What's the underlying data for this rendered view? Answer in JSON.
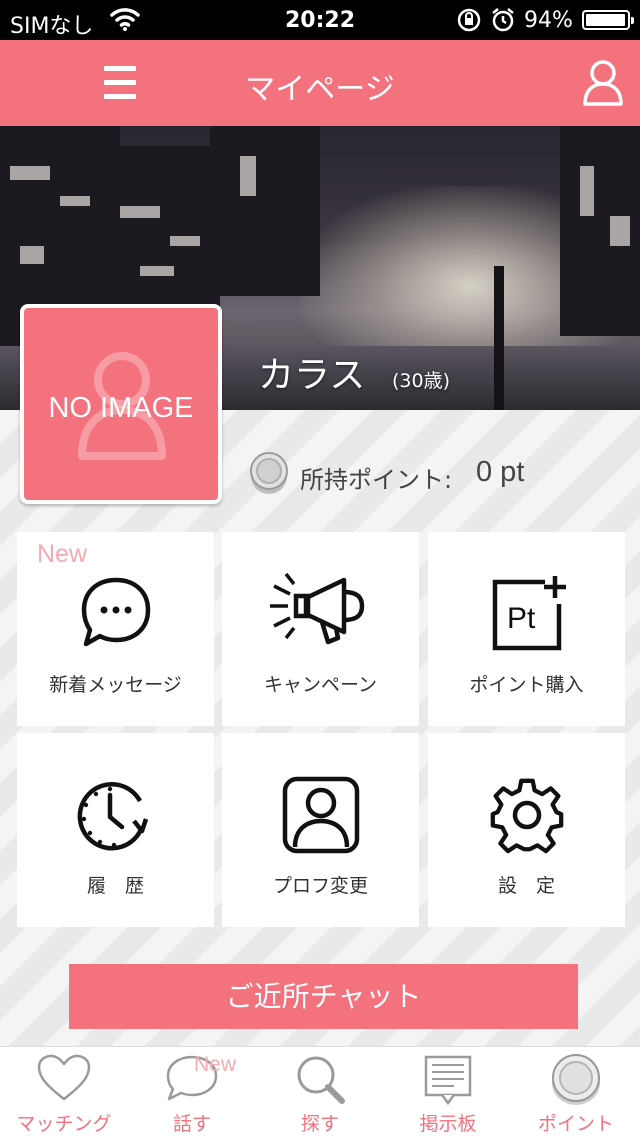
{
  "status_bar": {
    "carrier": "SIMなし",
    "time": "20:22",
    "battery_percent": "94%",
    "battery_level": 0.94,
    "icons": [
      "wifi-icon",
      "orientation-lock-icon",
      "alarm-icon",
      "battery-icon"
    ]
  },
  "header": {
    "title": "マイページ",
    "menu_icon": "hamburger-icon",
    "user_icon": "user-icon"
  },
  "profile": {
    "name": "カラス",
    "age": "(30歳)",
    "avatar_placeholder": "NO IMAGE",
    "points_label": "所持ポイント:",
    "points_value": "0 pt"
  },
  "tiles": [
    {
      "label": "新着メッセージ",
      "icon": "message-bubble-icon",
      "badge": "New"
    },
    {
      "label": "キャンペーン",
      "icon": "megaphone-icon"
    },
    {
      "label": "ポイント購入",
      "icon": "point-purchase-icon",
      "icon_text": "Pt"
    },
    {
      "label": "履　歴",
      "icon": "history-clock-icon"
    },
    {
      "label": "プロフ変更",
      "icon": "profile-edit-icon"
    },
    {
      "label": "設　定",
      "icon": "gear-icon"
    }
  ],
  "chat_button": {
    "label": "ご近所チャット"
  },
  "bottom_nav": {
    "items": [
      {
        "label": "マッチング",
        "icon": "heart-icon"
      },
      {
        "label": "話す",
        "icon": "speech-bubble-icon",
        "badge": "New"
      },
      {
        "label": "探す",
        "icon": "search-icon"
      },
      {
        "label": "掲示板",
        "icon": "bulletin-board-icon"
      },
      {
        "label": "ポイント",
        "icon": "coin-icon"
      }
    ]
  },
  "colors": {
    "accent": "#f4717e",
    "badge": "#f7a9b1",
    "text": "#333333"
  }
}
